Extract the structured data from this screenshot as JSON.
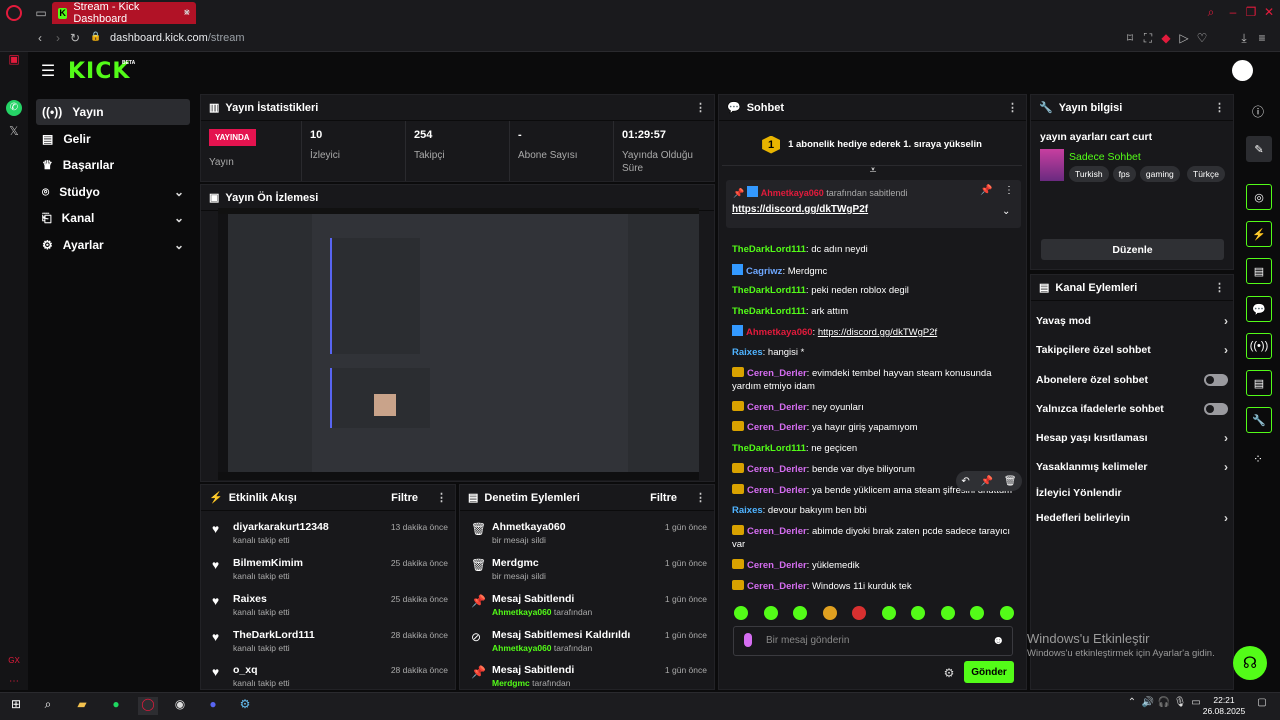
{
  "browser": {
    "tab_title": "Stream - Kick Dashboard",
    "url_host": "dashboard.kick.com",
    "url_path": "/stream"
  },
  "brand": {
    "logo": "KICK",
    "beta": "BETA"
  },
  "sidebar": {
    "items": [
      {
        "label": "Yayın",
        "icon": "broadcast-icon",
        "active": true
      },
      {
        "label": "Gelir",
        "icon": "wallet-icon"
      },
      {
        "label": "Başarılar",
        "icon": "trophy-icon"
      },
      {
        "label": "Stüdyo",
        "icon": "studio-icon",
        "expandable": true
      },
      {
        "label": "Kanal",
        "icon": "channel-icon",
        "expandable": true
      },
      {
        "label": "Ayarlar",
        "icon": "gear-icon",
        "expandable": true
      }
    ]
  },
  "stats": {
    "title": "Yayın İstatistikleri",
    "live_badge": "YAYINDA",
    "items": [
      {
        "value": "",
        "label": "Yayın"
      },
      {
        "value": "10",
        "label": "İzleyici"
      },
      {
        "value": "254",
        "label": "Takipçi"
      },
      {
        "value": "-",
        "label": "Abone Sayısı"
      },
      {
        "value": "01:29:57",
        "label": "Yayında Olduğu Süre"
      }
    ]
  },
  "preview": {
    "title": "Yayın Ön İzlemesi"
  },
  "activity": {
    "title": "Etkinlik Akışı",
    "filter": "Filtre",
    "items": [
      {
        "user": "diyarkarakurt12348",
        "action": "kanalı takip etti",
        "time": "13 dakika önce"
      },
      {
        "user": "BilmemKimim",
        "action": "kanalı takip etti",
        "time": "25 dakika önce"
      },
      {
        "user": "Raixes",
        "action": "kanalı takip etti",
        "time": "25 dakika önce"
      },
      {
        "user": "TheDarkLord111",
        "action": "kanalı takip etti",
        "time": "28 dakika önce"
      },
      {
        "user": "o_xq",
        "action": "kanalı takip etti",
        "time": "28 dakika önce"
      }
    ]
  },
  "moderation": {
    "title": "Denetim Eylemleri",
    "filter": "Filtre",
    "items": [
      {
        "title": "Ahmetkaya060",
        "sub": "bir mesajı sildi",
        "time": "1 gün önce",
        "icon": "trash-icon"
      },
      {
        "title": "Merdgmc",
        "sub": "bir mesajı sildi",
        "time": "1 gün önce",
        "icon": "trash-icon"
      },
      {
        "title": "Mesaj Sabitlendi",
        "sub_user": "Ahmetkaya060",
        "sub": "tarafından",
        "time": "1 gün önce",
        "icon": "pin-icon"
      },
      {
        "title": "Mesaj Sabitlemesi Kaldırıldı",
        "sub_user": "Ahmetkaya060",
        "sub": "tarafından",
        "time": "1 gün önce",
        "icon": "unpin-icon"
      },
      {
        "title": "Mesaj Sabitlendi",
        "sub_user": "Merdgmc",
        "sub": "tarafından",
        "time": "1 gün önce",
        "icon": "pin-icon"
      }
    ]
  },
  "chat": {
    "title": "Sohbet",
    "gift_rank": "1",
    "gift_text": "1 abonelik hediye ederek 1. sıraya yükselin",
    "pinned_user": "Ahmetkaya060",
    "pinned_by": "tarafından sabitlendi",
    "pinned_link": "https://discord.gg/dkTWgP2f",
    "messages": [
      {
        "user": "TheDarkLord111",
        "text": "dc adın neydi",
        "cls": "u-g"
      },
      {
        "user": "Cagriwz",
        "text": "Merdgmc",
        "cls": "u-s",
        "badge": "kick"
      },
      {
        "user": "TheDarkLord111",
        "text": "peki neden roblox degil",
        "cls": "u-g"
      },
      {
        "user": "TheDarkLord111",
        "text": "ark attım",
        "cls": "u-g"
      },
      {
        "user": "Ahmetkaya060",
        "text": "https://discord.gg/dkTWgP2f",
        "cls": "u-r",
        "badge": "kick",
        "link": true
      },
      {
        "user": "Raixes",
        "text": "hangisi *",
        "cls": "u-b"
      },
      {
        "user": "Ceren_Derler",
        "text": "evimdeki tembel hayvan steam konusunda yardım etmiyo idam",
        "cls": "u-p",
        "badge": "crown"
      },
      {
        "user": "Ceren_Derler",
        "text": "ney oyunları",
        "cls": "u-p",
        "badge": "crown"
      },
      {
        "user": "Ceren_Derler",
        "text": "ya hayır giriş yapamıyom",
        "cls": "u-p",
        "badge": "crown"
      },
      {
        "user": "TheDarkLord111",
        "text": "ne geçicen",
        "cls": "u-g"
      },
      {
        "user": "Ceren_Derler",
        "text": "bende var diye biliyorum",
        "cls": "u-p",
        "badge": "crown"
      },
      {
        "user": "Ceren_Derler",
        "text": "ya bende yüklicem ama steam şifresini unuttum",
        "cls": "u-p",
        "badge": "crown"
      },
      {
        "user": "Raixes",
        "text": "devour bakıyım ben bbi",
        "cls": "u-b"
      },
      {
        "user": "Ceren_Derler",
        "text": "abimde diyoki bırak zaten pcde sadece tarayıcı var",
        "cls": "u-p",
        "badge": "crown"
      },
      {
        "user": "Ceren_Derler",
        "text": "yüklemedik",
        "cls": "u-p",
        "badge": "crown"
      },
      {
        "user": "Ceren_Derler",
        "text": "Windows 11i kurduk tek",
        "cls": "u-p",
        "badge": "crown"
      }
    ],
    "input_placeholder": "Bir mesaj gönderin",
    "send_label": "Gönder"
  },
  "stream_info": {
    "title": "Yayın bilgisi",
    "stream_title": "yayın ayarları cart curt",
    "category": "Sadece Sohbet",
    "tags": [
      "Turkish",
      "fps",
      "gaming",
      "Türkçe"
    ],
    "edit_label": "Düzenle"
  },
  "channel_actions": {
    "title": "Kanal Eylemleri",
    "items": [
      {
        "label": "Yavaş mod",
        "type": "arrow"
      },
      {
        "label": "Takipçilere özel sohbet",
        "type": "arrow"
      },
      {
        "label": "Abonelere özel sohbet",
        "type": "toggle"
      },
      {
        "label": "Yalnızca ifadelerle sohbet",
        "type": "toggle"
      },
      {
        "label": "Hesap yaşı kısıtlaması",
        "type": "arrow"
      },
      {
        "label": "Yasaklanmış kelimeler",
        "type": "arrow"
      },
      {
        "label": "İzleyici Yönlendir",
        "type": "none"
      },
      {
        "label": "Hedefleri belirleyin",
        "type": "arrow"
      }
    ]
  },
  "windows": {
    "watermark_title": "Windows'u Etkinleştir",
    "watermark_sub": "Windows'u etkinleştirmek için Ayarlar'a gidin.",
    "time": "22:21",
    "date": "26.08.2025"
  },
  "colors": {
    "accent": "#53fc18",
    "live": "#e4134f",
    "opera": "#b11226"
  }
}
